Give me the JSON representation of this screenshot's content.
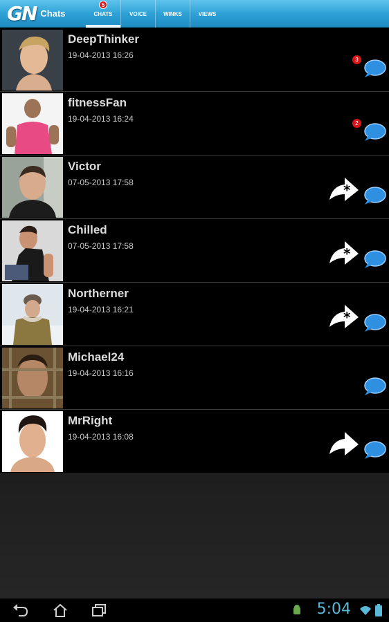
{
  "app": {
    "logo": "GN",
    "title": "Chats"
  },
  "tabs": [
    {
      "label": "CHATS",
      "badge": "5",
      "active": true
    },
    {
      "label": "VOICE",
      "badge": null,
      "active": false
    },
    {
      "label": "WINKS",
      "badge": null,
      "active": false
    },
    {
      "label": "VIEWS",
      "badge": null,
      "active": false
    }
  ],
  "chats": [
    {
      "name": "DeepThinker",
      "date": "19-04-2013 16:26",
      "unread": "3",
      "reply_icon": "none"
    },
    {
      "name": "fitnessFan",
      "date": "19-04-2013 16:24",
      "unread": "2",
      "reply_icon": "none"
    },
    {
      "name": "Victor",
      "date": "07-05-2013 17:58",
      "unread": null,
      "reply_icon": "reply-new-icon"
    },
    {
      "name": "Chilled",
      "date": "07-05-2013 17:58",
      "unread": null,
      "reply_icon": "reply-new-icon"
    },
    {
      "name": "Northerner",
      "date": "19-04-2013 16:21",
      "unread": null,
      "reply_icon": "reply-new-icon"
    },
    {
      "name": "Michael24",
      "date": "19-04-2013 16:16",
      "unread": null,
      "reply_icon": "none"
    },
    {
      "name": "MrRight",
      "date": "19-04-2013 16:08",
      "unread": null,
      "reply_icon": "reply-icon"
    }
  ],
  "system_bar": {
    "time": "5:04",
    "nav": [
      "back-icon",
      "home-icon",
      "recent-apps-icon"
    ],
    "status": [
      "android-debug-icon",
      "wifi-icon",
      "battery-icon"
    ]
  },
  "colors": {
    "action_bar": "#2ea2d6",
    "badge": "#d8151b",
    "chat_bubble": "#2f8fe0",
    "clock": "#5ab9d8"
  }
}
